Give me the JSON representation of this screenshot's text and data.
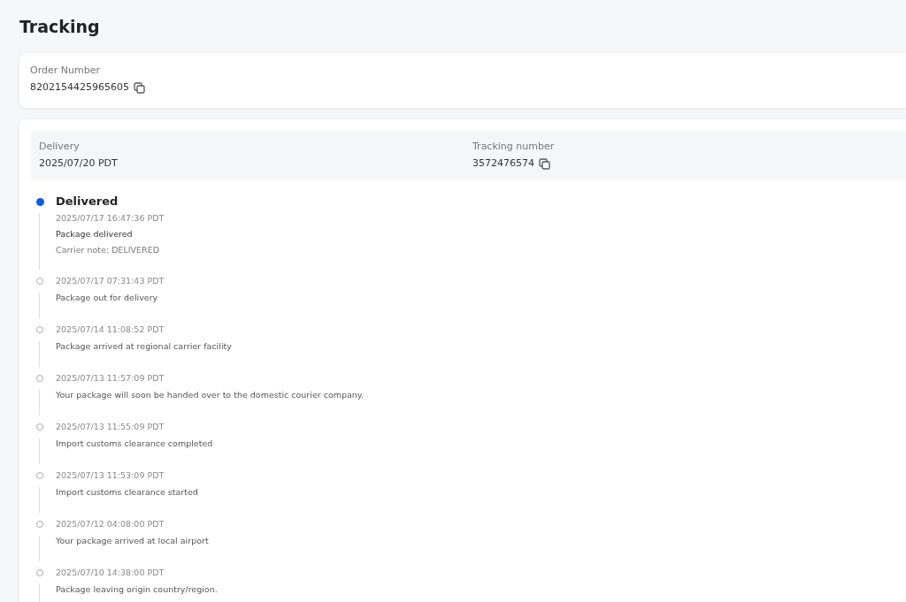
{
  "page_title": "Tracking",
  "order": {
    "label": "Order Number",
    "value": "8202154425965605"
  },
  "summary": [
    {
      "label": "Delivery",
      "value": "2025/07/20 PDT",
      "copyable": false
    },
    {
      "label": "Tracking number",
      "value": "3572476574",
      "copyable": true
    }
  ],
  "events": [
    {
      "current": true,
      "status": "Delivered",
      "time": "2025/07/17 16:47:36 PDT",
      "description": "Package delivered",
      "note": "Carrier note: DELIVERED"
    },
    {
      "current": false,
      "time": "2025/07/17 07:31:43 PDT",
      "description": "Package out for delivery"
    },
    {
      "current": false,
      "time": "2025/07/14 11:08:52 PDT",
      "description": "Package arrived at regional carrier facility"
    },
    {
      "current": false,
      "time": "2025/07/13 11:57:09 PDT",
      "description": "Your package will soon be handed over to the domestic courier company."
    },
    {
      "current": false,
      "time": "2025/07/13 11:55:09 PDT",
      "description": "Import customs clearance completed"
    },
    {
      "current": false,
      "time": "2025/07/13 11:53:09 PDT",
      "description": "Import customs clearance started"
    },
    {
      "current": false,
      "time": "2025/07/12 04:08:00 PDT",
      "description": "Your package arrived at local airport"
    },
    {
      "current": false,
      "time": "2025/07/10 14:38:00 PDT",
      "description": "Package leaving origin country/region."
    }
  ]
}
